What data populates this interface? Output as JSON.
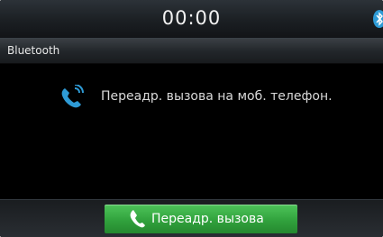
{
  "status_bar": {
    "clock": "00:00",
    "bluetooth_icon": "bluetooth-icon",
    "bluetooth_color": "#2e9bd6"
  },
  "header": {
    "title": "Bluetooth"
  },
  "main": {
    "icon": "call-forward-icon",
    "icon_color": "#2e9bd6",
    "message": "Переадр. вызова на моб. телефон."
  },
  "footer": {
    "forward_button_label": "Переадр. вызова",
    "forward_button_icon": "phone-icon",
    "button_color": "#34a640"
  }
}
